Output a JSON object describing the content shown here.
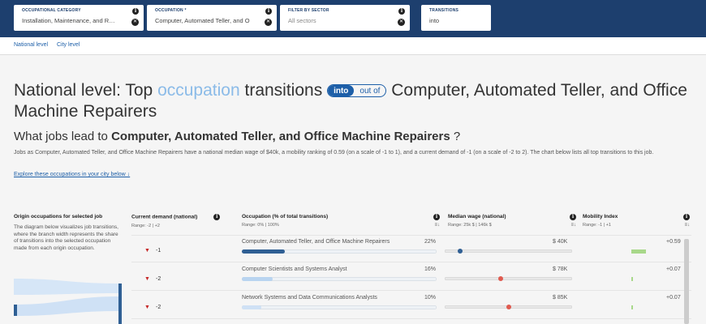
{
  "filters": {
    "category": {
      "label": "OCCUPATIONAL CATEGORY",
      "value": "Installation, Maintenance, and Repa"
    },
    "occupation": {
      "label": "OCCUPATION *",
      "value": "Computer, Automated Teller, and O"
    },
    "sector": {
      "label": "FILTER BY SECTOR",
      "placeholder": "All sectors"
    },
    "transitions": {
      "label": "TRANSITIONS",
      "value": "into"
    }
  },
  "subnav": {
    "national": "National level",
    "city": "City level"
  },
  "heading": {
    "pre": "National level: Top",
    "highlight": "occupation",
    "mid": "transitions",
    "toggle_on": "into",
    "toggle_off": "out of",
    "post": "Computer, Automated Teller, and Office Machine Repairers"
  },
  "subheading": {
    "pre": "What jobs lead to",
    "bold": "Computer, Automated Teller, and Office Machine Repairers",
    "post": "?"
  },
  "description": "Jobs as Computer, Automated Teller, and Office Machine Repairers have a national median wage of $40k, a mobility ranking of 0.59 (on a scale of -1 to 1), and a current demand of -1 (on a scale of -2 to 2). The chart below lists all top transitions to this job.",
  "explore_link": "Explore these occupations in your city below ↓",
  "left_panel": {
    "title": "Origin occupations for selected job",
    "text": "The diagram below visualizes job transitions, where the branch width represents the share of transitions into the selected occupation made from each origin occupation."
  },
  "columns": {
    "demand": {
      "title": "Current demand (national)",
      "range": "Range: -2 | +2"
    },
    "occupation": {
      "title": "Occupation (% of total transitions)",
      "range": "Range: 0% | 100%"
    },
    "wage": {
      "title": "Median wage (national)",
      "range": "Range: 25k $ | 146k $"
    },
    "mobility": {
      "title": "Mobility Index",
      "range": "Range: -1 | +1"
    }
  },
  "rows": [
    {
      "demand": "-1",
      "occupation": "Computer, Automated Teller, and Office Machine Repairers",
      "pct": "22%",
      "share": 0.22,
      "wage": "$ 40K",
      "wage_pos": 0.12,
      "mobility": "+0.59",
      "mob_value": 0.59,
      "fill_color": "#2f5f94",
      "dot_color": "#2f5f94"
    },
    {
      "demand": "-2",
      "occupation": "Computer Scientists and Systems Analyst",
      "pct": "16%",
      "share": 0.16,
      "wage": "$ 78K",
      "wage_pos": 0.44,
      "mobility": "+0.07",
      "mob_value": 0.07,
      "fill_color": "#b9d4f0",
      "dot_color": "#e05a4f"
    },
    {
      "demand": "-2",
      "occupation": "Network Systems and Data Communications Analysts",
      "pct": "10%",
      "share": 0.1,
      "wage": "$ 85K",
      "wage_pos": 0.5,
      "mobility": "+0.07",
      "mob_value": 0.07,
      "fill_color": "#cfe1f5",
      "dot_color": "#e05a4f"
    }
  ]
}
